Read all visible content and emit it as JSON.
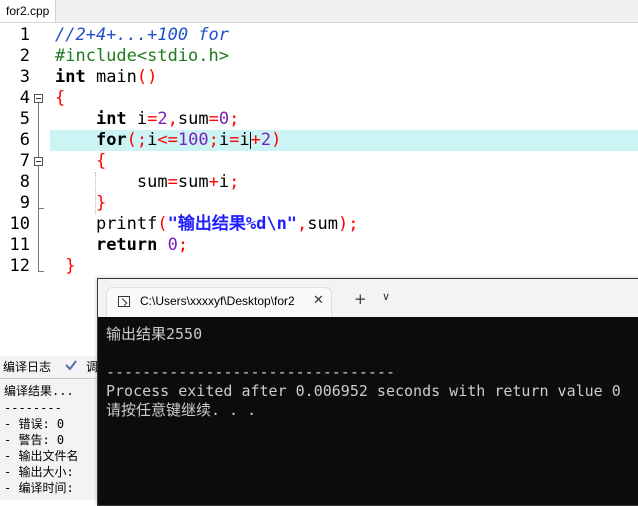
{
  "file_tab": {
    "label": "for2.cpp"
  },
  "editor": {
    "line_numbers": [
      "1",
      "2",
      "3",
      "4",
      "5",
      "6",
      "7",
      "8",
      "9",
      "10",
      "11",
      "12"
    ],
    "lines": {
      "l1": {
        "comment": "//2+4+...+100 for"
      },
      "l2": {
        "pp": "#include<stdio.h>"
      },
      "l3": {
        "kw": "int",
        "rest": " main",
        "p": "()"
      },
      "l4": {
        "brace": "{"
      },
      "l5": {
        "indent": "    ",
        "kw": "int",
        "a": " i",
        "eq": "=",
        "n2": "2",
        "comma": ",",
        "b": "sum",
        "eq2": "=",
        "n0": "0",
        "semi": ";"
      },
      "l6": {
        "indent": "    ",
        "kw": "for",
        "p1": "(;",
        "a": "i",
        "le": "<=",
        "n100": "100",
        "s": ";",
        "b": "i",
        "eq": "=",
        "c": "i",
        "plus": "+",
        "n2": "2",
        "p2": ")"
      },
      "l7": {
        "indent": "    ",
        "brace": "{"
      },
      "l8": {
        "indent": "        ",
        "a": "sum",
        "eq": "=",
        "b": "sum",
        "plus": "+",
        "c": "i",
        "semi": ";"
      },
      "l9": {
        "indent": "    ",
        "brace": "}"
      },
      "l10": {
        "indent": "    ",
        "fn": "printf",
        "p1": "(",
        "str": "\"输出结果%d\\n\"",
        "comma": ",",
        "a": "sum",
        "p2": ")",
        "semi": ";"
      },
      "l11": {
        "indent": "    ",
        "kw": "return",
        "sp": " ",
        "n0": "0",
        "semi": ";"
      },
      "l12": {
        "brace": " }"
      }
    }
  },
  "bottom_panel": {
    "tab_compile_log": "编译日志",
    "tab_second": "调",
    "log": [
      "编译结果...",
      "--------",
      "- 错误: 0",
      "- 警告: 0",
      "- 输出文件名",
      "- 输出大小:",
      "- 编译时间:"
    ]
  },
  "console": {
    "tab_title": "C:\\Users\\xxxxyf\\Desktop\\for2",
    "close_glyph": "✕",
    "plus_glyph": "+",
    "dropdown_glyph": "∨",
    "output_line1": "输出结果2550",
    "separator": "--------------------------------",
    "exit_line": "Process exited after 0.006952 seconds with return value 0",
    "prompt_line": "请按任意键继续. . ."
  },
  "colors": {
    "comment": "#1f50c8",
    "preprocessor": "#1d7a1d",
    "number": "#7a1fbf",
    "string": "#2020ff",
    "operator": "#ff0000",
    "current_line": "#ccf4f4",
    "console_bg": "#0c0c0c"
  }
}
